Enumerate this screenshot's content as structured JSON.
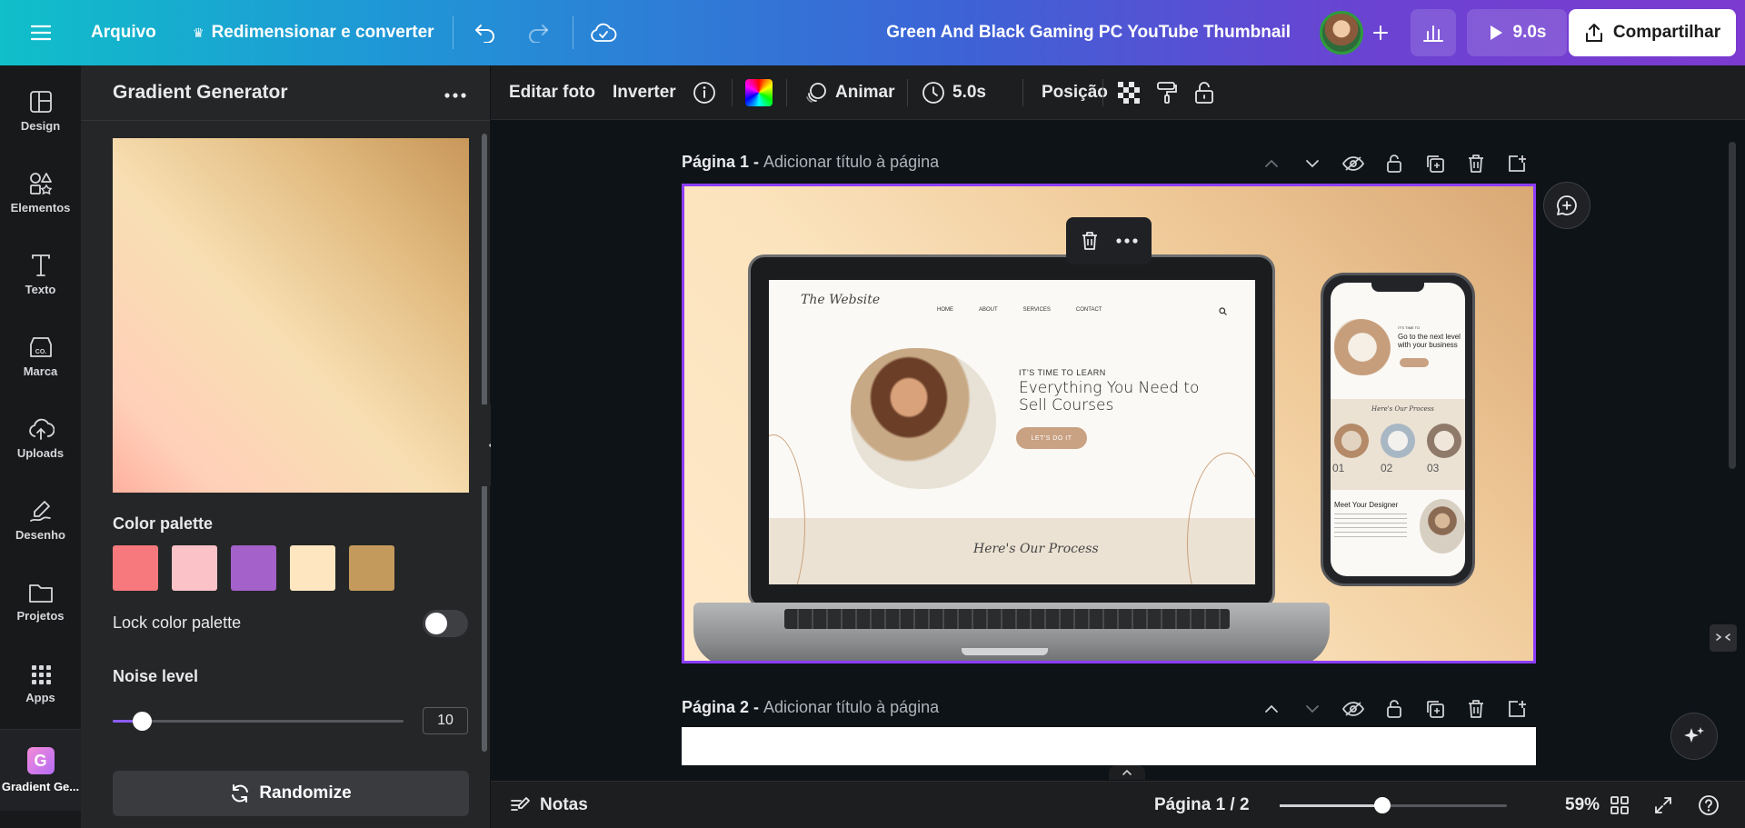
{
  "topbar": {
    "file_label": "Arquivo",
    "resize_label": "Redimensionar e converter",
    "doc_title": "Green And Black Gaming PC YouTube Thumbnail",
    "play_duration": "9.0s",
    "share_label": "Compartilhar"
  },
  "rail": {
    "items": [
      {
        "label": "Design",
        "icon": "design-icon"
      },
      {
        "label": "Elementos",
        "icon": "elements-icon"
      },
      {
        "label": "Texto",
        "icon": "text-icon"
      },
      {
        "label": "Marca",
        "icon": "brand-icon"
      },
      {
        "label": "Uploads",
        "icon": "upload-icon"
      },
      {
        "label": "Desenho",
        "icon": "draw-icon"
      },
      {
        "label": "Projetos",
        "icon": "folder-icon"
      },
      {
        "label": "Apps",
        "icon": "apps-icon"
      }
    ],
    "active_app": {
      "label": "Gradient Ge...",
      "glyph": "G"
    }
  },
  "panel": {
    "title": "Gradient Generator",
    "palette_label": "Color palette",
    "palette": [
      "#f7797d",
      "#fbc2c8",
      "#a461c9",
      "#fde6c0",
      "#c49a5c"
    ],
    "lock_label": "Lock color palette",
    "lock_on": false,
    "noise_label": "Noise level",
    "noise_value": "10",
    "noise_fraction": 0.1,
    "randomize_label": "Randomize"
  },
  "context_toolbar": {
    "edit_photo": "Editar foto",
    "flip": "Inverter",
    "animate": "Animar",
    "duration": "5.0s",
    "position": "Posição"
  },
  "canvas": {
    "page1_label": "Página 1 - ",
    "page1_hint": "Adicionar título à página",
    "page2_label": "Página 2 - ",
    "page2_hint": "Adicionar título à página",
    "design": {
      "site_logo": "The Website",
      "nav": [
        "HOME",
        "ABOUT",
        "SERVICES",
        "CONTACT"
      ],
      "kicker": "IT'S TIME TO LEARN",
      "headline": "Everything You Need to Sell Courses",
      "cta": "LET'S DO IT",
      "process_script": "Here's Our Process",
      "phone_kicker": "IT'S TIME TO",
      "phone_headline": "Go to the next level with your business",
      "phone_process": "Here's Our Process",
      "phone_steps": [
        "01",
        "02",
        "03"
      ],
      "phone_meet": "Meet Your Designer"
    }
  },
  "bottombar": {
    "notes_label": "Notas",
    "page_indicator": "Página 1 / 2",
    "zoom_percent": "59%",
    "zoom_fraction": 0.45
  },
  "colors": {
    "accent": "#8b3dff",
    "topbar_start": "#10bfc9",
    "topbar_end": "#7c3ad0"
  }
}
